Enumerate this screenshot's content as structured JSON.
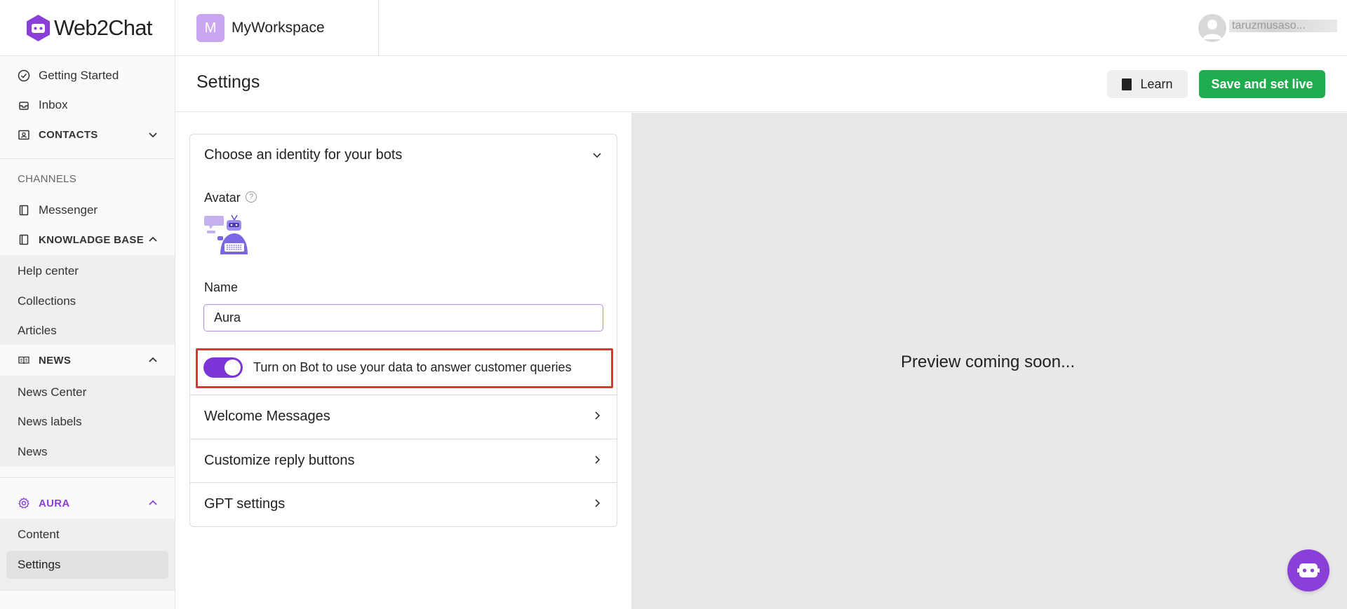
{
  "app": {
    "logo_text": "Web2Chat",
    "brand_color": "#8b3fd9",
    "accent_green": "#1fac4f"
  },
  "topbar": {
    "workspace_initial": "M",
    "workspace_name": "MyWorkspace",
    "user_name": "taruzmusaso..."
  },
  "sidebar": {
    "getting_started": "Getting Started",
    "inbox": "Inbox",
    "contacts": "CONTACTS",
    "channels_section": "CHANNELS",
    "messenger": "Messenger",
    "knowledge_base": "KNOWLADGE BASE",
    "kb_items": [
      "Help center",
      "Collections",
      "Articles"
    ],
    "news": "NEWS",
    "news_items": [
      "News Center",
      "News labels",
      "News"
    ],
    "aura": "AURA",
    "aura_items": [
      "Content",
      "Settings"
    ]
  },
  "header": {
    "title": "Settings",
    "learn_label": "Learn",
    "save_label": "Save and set live"
  },
  "identity": {
    "title": "Choose an identity for your bots",
    "avatar_label": "Avatar",
    "help_glyph": "?",
    "name_label": "Name",
    "name_value": "Aura",
    "toggle_label": "Turn on Bot to use your data to answer customer queries",
    "toggle_on": true
  },
  "sections": [
    "Welcome Messages",
    "Customize reply buttons",
    "GPT settings"
  ],
  "preview": {
    "text": "Preview coming soon..."
  }
}
